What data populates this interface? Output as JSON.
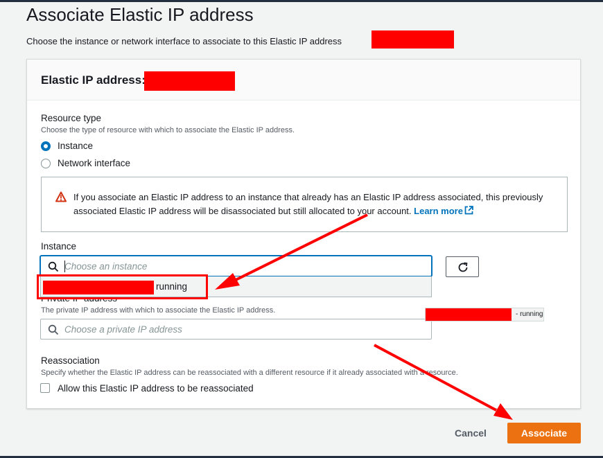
{
  "page": {
    "title": "Associate Elastic IP address",
    "description": "Choose the instance or network interface to associate to this Elastic IP address"
  },
  "panel": {
    "title": "Elastic IP address:"
  },
  "resource_type": {
    "label": "Resource type",
    "hint": "Choose the type of resource with which to associate the Elastic IP address.",
    "options": [
      {
        "label": "Instance",
        "selected": true
      },
      {
        "label": "Network interface",
        "selected": false
      }
    ]
  },
  "alert": {
    "icon": "warning-icon",
    "text": "If you associate an Elastic IP address to an instance that already has an Elastic IP address associated, this previously associated Elastic IP address will be disassociated but still allocated to your account.",
    "link": "Learn more",
    "color": "#d13212"
  },
  "instance": {
    "label": "Instance",
    "placeholder": "Choose an instance",
    "dropdown_state": "running"
  },
  "private_ip": {
    "label": "Private IP address",
    "hint": "The private IP address with which to associate the Elastic IP address.",
    "placeholder": "Choose a private IP address",
    "tooltip_state": "- running"
  },
  "reassociation": {
    "label": "Reassociation",
    "hint": "Specify whether the Elastic IP address can be reassociated with a different resource if it already associated with a resource.",
    "checkbox_label": "Allow this Elastic IP address to be reassociated",
    "checked": false
  },
  "footer": {
    "cancel": "Cancel",
    "submit": "Associate"
  },
  "colors": {
    "accent": "#0073bb",
    "primary_button": "#ec7211",
    "annotation": "#ff0000"
  }
}
